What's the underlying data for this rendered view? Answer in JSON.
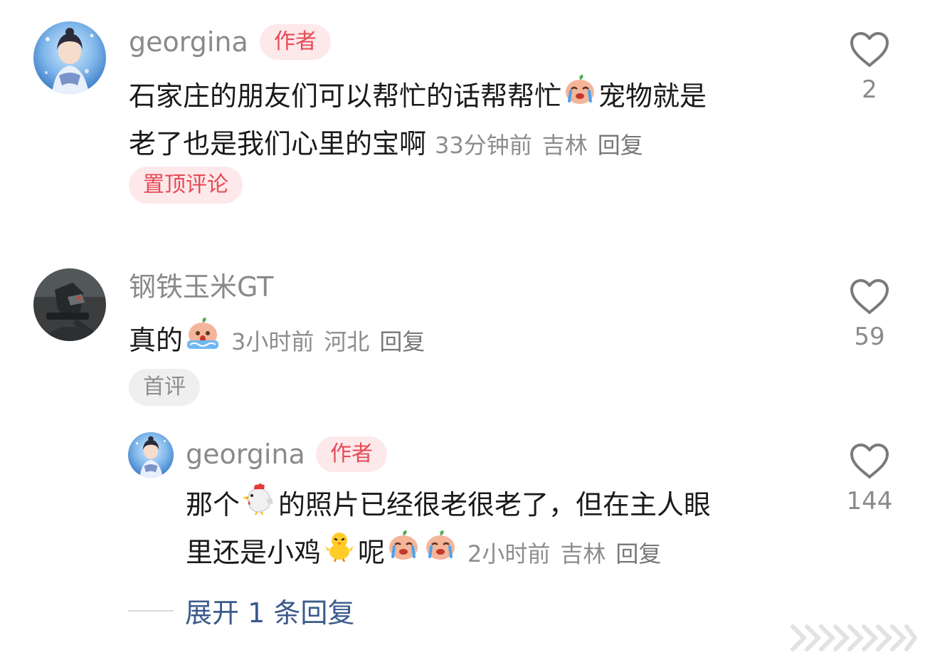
{
  "comments": [
    {
      "username": "georgina",
      "badge": "作者",
      "text_line1_a": "石家庄的朋友们可以帮忙的话帮帮忙",
      "text_line1_b": "宠物就是",
      "text_line2": "老了也是我们心里的宝啊",
      "time": "33分钟前",
      "location": "吉林",
      "reply": "回复",
      "tag": "置顶评论",
      "likes": "2",
      "emojis": [
        "crying-face-emoji"
      ]
    },
    {
      "username": "钢铁玉米GT",
      "text": "真的",
      "time": "3小时前",
      "location": "河北",
      "reply": "回复",
      "tag": "首评",
      "likes": "59",
      "emojis": [
        "scared-crying-face-emoji"
      ]
    }
  ],
  "reply": {
    "username": "georgina",
    "badge": "作者",
    "text_line1_a": "那个",
    "text_line1_b": "的照片已经很老很老了，但在主人眼",
    "text_line2_a": "里还是小鸡",
    "text_line2_b": "呢",
    "time": "2小时前",
    "location": "吉林",
    "reply": "回复",
    "likes": "144",
    "emojis": [
      "rooster-emoji",
      "chick-emoji",
      "crying-face-emoji",
      "crying-face-emoji"
    ]
  },
  "expand_replies": "展开 1 条回复",
  "icons": {
    "like": "heart-outline-icon",
    "watermark": "weibo-watermark-icon"
  },
  "colors": {
    "badge_text": "#e64a56",
    "badge_bg": "#fde8ea",
    "link": "#3a5a8c",
    "meta": "#8d8d8d"
  }
}
